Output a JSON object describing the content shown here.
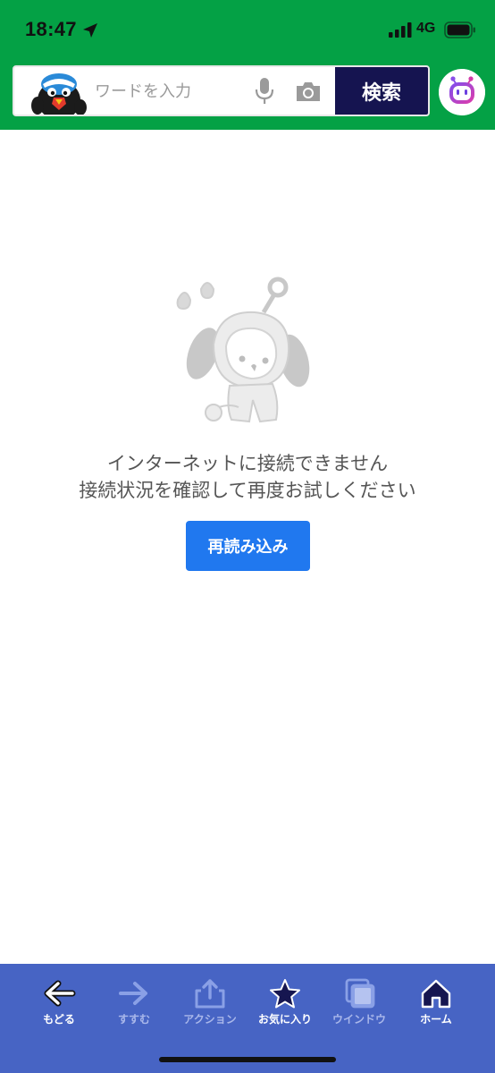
{
  "status_bar": {
    "time": "18:47",
    "network": "4G"
  },
  "search": {
    "placeholder": "ワードを入力",
    "value": "",
    "button_label": "検索"
  },
  "error": {
    "line1": "インターネットに接続できません",
    "line2": "接続状況を確認して再度お試しください",
    "reload_label": "再読み込み"
  },
  "bottom_nav": {
    "items": [
      {
        "label": "もどる",
        "icon": "back-arrow-icon",
        "active": true
      },
      {
        "label": "すすむ",
        "icon": "forward-arrow-icon",
        "active": false
      },
      {
        "label": "アクション",
        "icon": "share-icon",
        "active": false
      },
      {
        "label": "お気に入り",
        "icon": "star-icon",
        "active": true
      },
      {
        "label": "ウインドウ",
        "icon": "windows-icon",
        "active": false
      },
      {
        "label": "ホーム",
        "icon": "home-icon",
        "active": true
      }
    ]
  },
  "colors": {
    "header_green": "#04a145",
    "search_button": "#151450",
    "reload_button": "#2078ef",
    "bottom_bar": "#4764c4"
  }
}
